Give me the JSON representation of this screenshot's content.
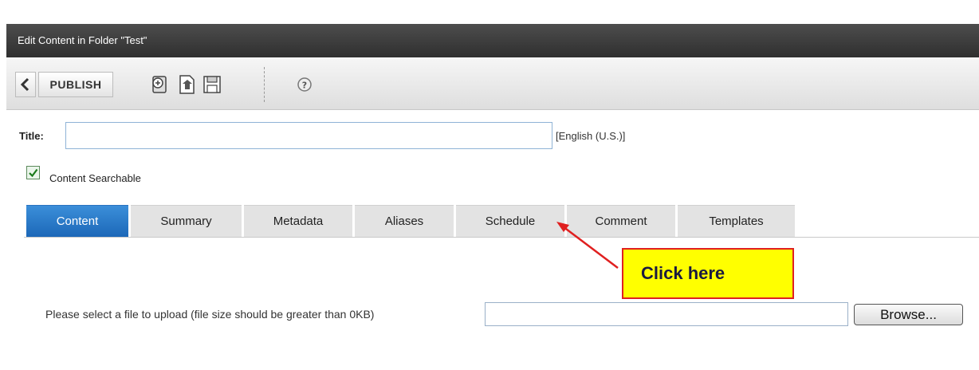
{
  "window": {
    "title": "Edit Content in Folder \"Test\""
  },
  "toolbar": {
    "publish_label": "PUBLISH",
    "icons": [
      "back-icon",
      "checkin-icon",
      "export-icon",
      "save-icon",
      "help-icon"
    ]
  },
  "form": {
    "title_label": "Title:",
    "title_value": "",
    "language": "[English (U.S.)]",
    "searchable_label": "Content Searchable",
    "searchable_checked": true
  },
  "tabs": [
    {
      "label": "Content",
      "active": true
    },
    {
      "label": "Summary",
      "active": false
    },
    {
      "label": "Metadata",
      "active": false
    },
    {
      "label": "Aliases",
      "active": false
    },
    {
      "label": "Schedule",
      "active": false
    },
    {
      "label": "Comment",
      "active": false
    },
    {
      "label": "Templates",
      "active": false
    }
  ],
  "annotation": {
    "text": "Click here",
    "bg": "#ffff00",
    "border": "#e02020"
  },
  "upload": {
    "label": "Please select a file to upload (file size should be greater than 0KB)",
    "browse_label": "Browse..."
  },
  "colors": {
    "accent": "#1c68b8",
    "header": "#3a3a3a"
  }
}
